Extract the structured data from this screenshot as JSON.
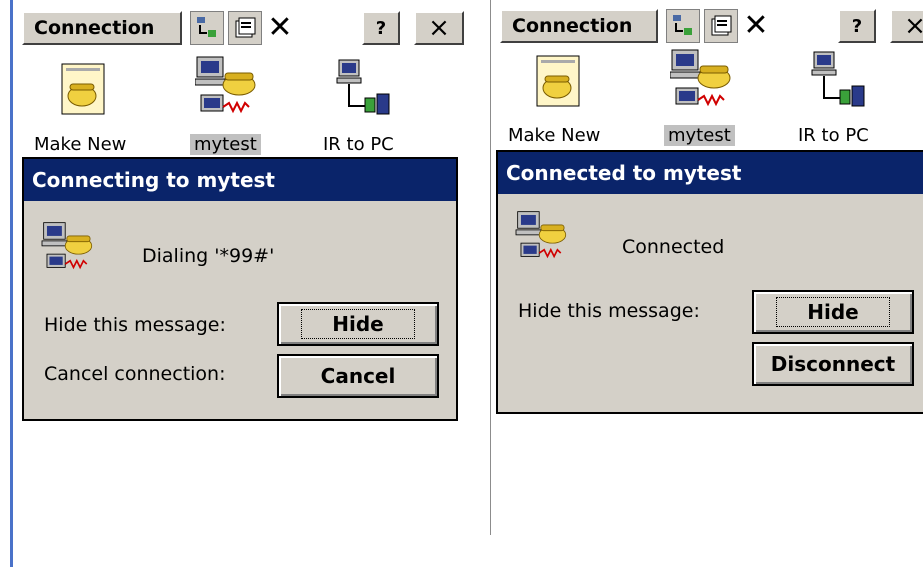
{
  "left": {
    "toolbar": {
      "title": "Connection",
      "help": "?",
      "close": "×"
    },
    "icons": [
      {
        "label": "Make New",
        "icon": "make-new-connection-icon"
      },
      {
        "label": "mytest",
        "icon": "dialup-connection-icon",
        "selected": true
      },
      {
        "label": "IR to PC",
        "icon": "ir-to-pc-icon"
      }
    ],
    "dialog": {
      "title": "Connecting to mytest",
      "status": "Dialing '*99#'",
      "hide_prompt": "Hide this message:",
      "hide_button": "Hide",
      "cancel_prompt": "Cancel connection:",
      "cancel_button": "Cancel"
    }
  },
  "right": {
    "toolbar": {
      "title": "Connection",
      "help": "?",
      "close": "×"
    },
    "icons": [
      {
        "label": "Make New",
        "icon": "make-new-connection-icon"
      },
      {
        "label": "mytest",
        "icon": "dialup-connection-icon",
        "selected": true
      },
      {
        "label": "IR to PC",
        "icon": "ir-to-pc-icon"
      }
    ],
    "dialog": {
      "title": "Connected to mytest",
      "status": "Connected",
      "hide_prompt": "Hide this message:",
      "hide_button": "Hide",
      "disconnect_button": "Disconnect"
    }
  },
  "colors": {
    "title_bar": "#0a246a",
    "dialog_bg": "#d4d0c8",
    "accent_line": "#4a72c9"
  }
}
